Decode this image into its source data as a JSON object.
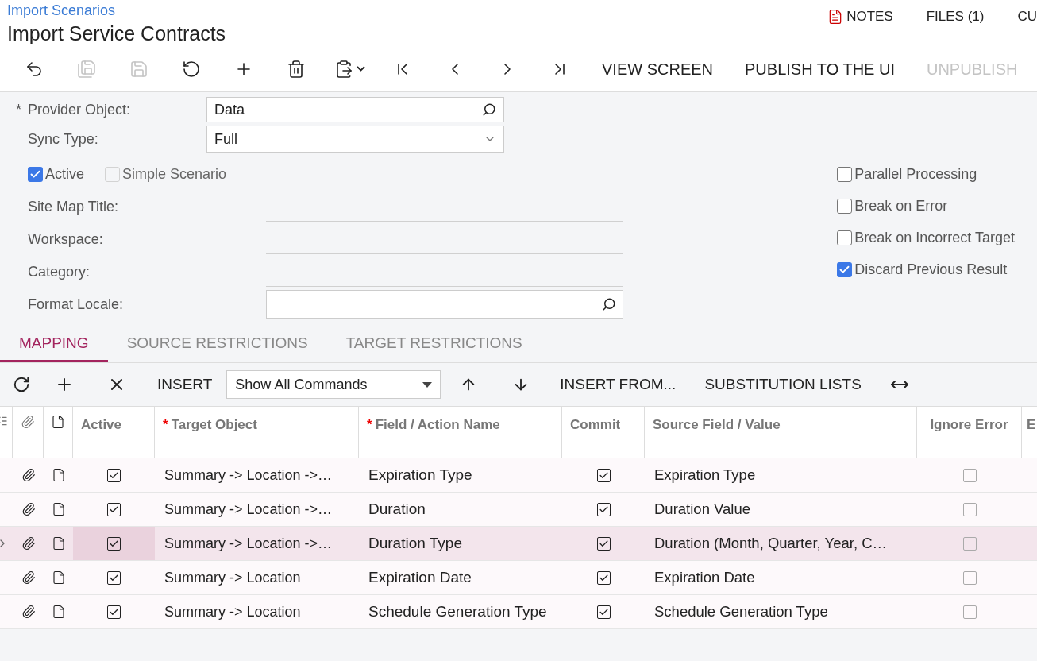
{
  "breadcrumb": "Import Scenarios",
  "title": "Import Service Contracts",
  "header_links": [
    {
      "label": "NOTES",
      "kind": "notes"
    },
    {
      "label": "FILES (1)",
      "kind": "text"
    },
    {
      "label": "CU",
      "kind": "text"
    }
  ],
  "toolbar": {
    "icon_buttons": [
      {
        "disabled": false
      },
      {
        "disabled": true
      },
      {
        "disabled": true
      },
      {
        "disabled": false
      },
      {
        "disabled": false
      },
      {
        "disabled": false
      },
      {
        "disabled": false
      },
      {
        "disabled": false
      },
      {
        "disabled": false
      },
      {
        "disabled": false
      },
      {
        "disabled": false
      }
    ],
    "text_buttons": [
      {
        "label": "VIEW SCREEN",
        "disabled": false
      },
      {
        "label": "PUBLISH TO THE UI",
        "disabled": false
      },
      {
        "label": "UNPUBLISH",
        "disabled": true
      }
    ]
  },
  "form": {
    "provider_object": {
      "label": "Provider Object:",
      "value": "Data",
      "marker": "*"
    },
    "sync_type": {
      "label": "Sync Type:",
      "value": "Full"
    },
    "checks_left": [
      {
        "label": "Active",
        "checked": true,
        "disabled": false
      },
      {
        "label": "Simple Scenario",
        "checked": false,
        "disabled": true
      }
    ],
    "site_map_title": {
      "label": "Site Map Title:"
    },
    "workspace": {
      "label": "Workspace:"
    },
    "category": {
      "label": "Category:"
    },
    "format_locale": {
      "label": "Format Locale:"
    },
    "checks_right": [
      {
        "label": "Parallel Processing",
        "checked": false
      },
      {
        "label": "Break on Error",
        "checked": false
      },
      {
        "label": "Break on Incorrect Target",
        "checked": false
      },
      {
        "label": "Discard Previous Result",
        "checked": true
      }
    ]
  },
  "tabs": [
    {
      "label": "MAPPING",
      "selected": true
    },
    {
      "label": "SOURCE RESTRICTIONS",
      "selected": false
    },
    {
      "label": "TARGET RESTRICTIONS",
      "selected": false
    }
  ],
  "grid_toolbar": {
    "insert": "INSERT",
    "dropdown": "Show All Commands",
    "insert_from": "INSERT FROM...",
    "substitution_lists": "SUBSTITUTION LISTS"
  },
  "columns": [
    {
      "label": "Active"
    },
    {
      "label": "Target Object",
      "marker": "*"
    },
    {
      "label": "Field / Action Name",
      "marker": "*"
    },
    {
      "label": "Commit"
    },
    {
      "label": "Source Field / Value"
    },
    {
      "label": "Ignore Error"
    },
    {
      "label": "E"
    }
  ],
  "rows": [
    {
      "active": true,
      "target_object": "Summary -> Location ->…",
      "field": "Expiration Type",
      "commit": true,
      "source": "Expiration Type",
      "ignore_error": false,
      "selected": false
    },
    {
      "active": true,
      "target_object": "Summary -> Location ->…",
      "field": "Duration",
      "commit": true,
      "source": "Duration Value",
      "ignore_error": false,
      "selected": false
    },
    {
      "active": true,
      "target_object": "Summary -> Location ->…",
      "field": "Duration Type",
      "commit": true,
      "source": "Duration (Month, Quarter, Year, C…",
      "ignore_error": false,
      "selected": true
    },
    {
      "active": true,
      "target_object": "Summary -> Location",
      "field": "Expiration Date",
      "commit": true,
      "source": "Expiration Date",
      "ignore_error": false,
      "selected": false
    },
    {
      "active": true,
      "target_object": "Summary -> Location",
      "field": "Schedule Generation Type",
      "commit": true,
      "source": "Schedule Generation Type",
      "ignore_error": false,
      "selected": false
    }
  ]
}
